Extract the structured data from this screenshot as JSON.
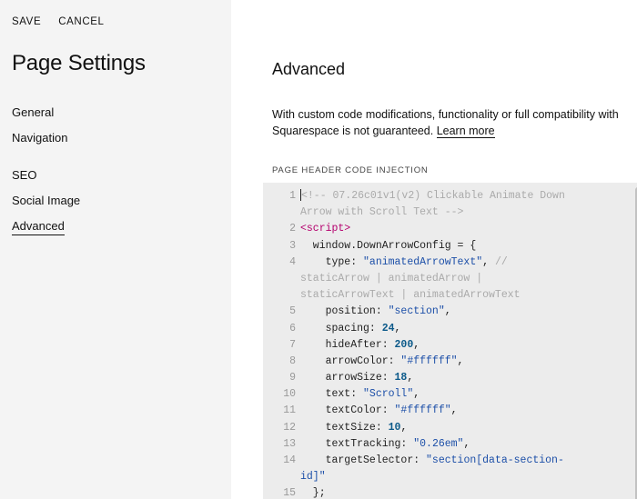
{
  "header": {
    "save_label": "SAVE",
    "cancel_label": "CANCEL"
  },
  "sidebar": {
    "title": "Page Settings",
    "items": [
      {
        "label": "General"
      },
      {
        "label": "Navigation"
      },
      {
        "label": "SEO"
      },
      {
        "label": "Social Image"
      },
      {
        "label": "Advanced"
      }
    ],
    "active_item": "Advanced"
  },
  "main": {
    "title": "Advanced",
    "description_line1": "With custom code modifications, functionality or full compatibility with",
    "description_line2": "Squarespace is not guaranteed.",
    "learn_more": "Learn more",
    "section_label": "PAGE HEADER CODE INJECTION"
  },
  "code": {
    "lines": [
      {
        "n": "1",
        "comment": "<!-- 07.26c01v1(v2) Clickable Animate Down"
      },
      {
        "n": "",
        "comment": "Arrow with Scroll Text -->"
      },
      {
        "n": "2",
        "tag": "<script>"
      },
      {
        "n": "3",
        "text": "  window.DownArrowConfig = {"
      },
      {
        "n": "4",
        "key": "    type: ",
        "str": "\"animatedArrowText\"",
        "after": ",",
        "comment": " //"
      },
      {
        "n": "",
        "comment": "staticArrow | animatedArrow |"
      },
      {
        "n": "",
        "comment": "staticArrowText | animatedArrowText"
      },
      {
        "n": "5",
        "key": "    position: ",
        "str": "\"section\"",
        "after": ","
      },
      {
        "n": "6",
        "key": "    spacing: ",
        "num": "24",
        "after": ","
      },
      {
        "n": "7",
        "key": "    hideAfter: ",
        "num": "200",
        "after": ","
      },
      {
        "n": "8",
        "key": "    arrowColor: ",
        "str": "\"#ffffff\"",
        "after": ","
      },
      {
        "n": "9",
        "key": "    arrowSize: ",
        "num": "18",
        "after": ","
      },
      {
        "n": "10",
        "key": "    text: ",
        "str": "\"Scroll\"",
        "after": ","
      },
      {
        "n": "11",
        "key": "    textColor: ",
        "str": "\"#ffffff\"",
        "after": ","
      },
      {
        "n": "12",
        "key": "    textSize: ",
        "num": "10",
        "after": ","
      },
      {
        "n": "13",
        "key": "    textTracking: ",
        "str": "\"0.26em\"",
        "after": ","
      },
      {
        "n": "14",
        "key": "    targetSelector: ",
        "str": "\"section[data-section-"
      },
      {
        "n": "",
        "str": "id]\""
      },
      {
        "n": "15",
        "text": "  };"
      }
    ]
  },
  "colors": {
    "sidebar_bg": "#f4f4f4",
    "editor_bg": "#ececec",
    "tag": "#b5006e",
    "string": "#1c4fa8",
    "number": "#0c5a8a",
    "comment": "#aaaaaa"
  }
}
